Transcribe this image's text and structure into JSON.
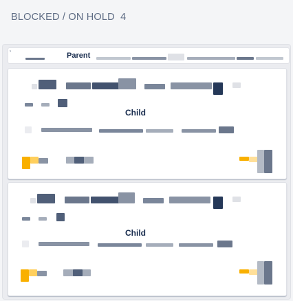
{
  "column": {
    "title": "BLOCKED / ON HOLD",
    "count": "4"
  },
  "parent": {
    "label": "Parent",
    "chevron_icon": "chevron-icon"
  },
  "cards": [
    {
      "label": "Child",
      "status_color": "#f9b000"
    },
    {
      "label": "Child",
      "status_color": "#f9b000"
    }
  ],
  "colors": {
    "accent": "#f9b000",
    "redacted_dark": "#505f79",
    "redacted_light": "#c1c7d0",
    "navy": "#172b4d"
  }
}
